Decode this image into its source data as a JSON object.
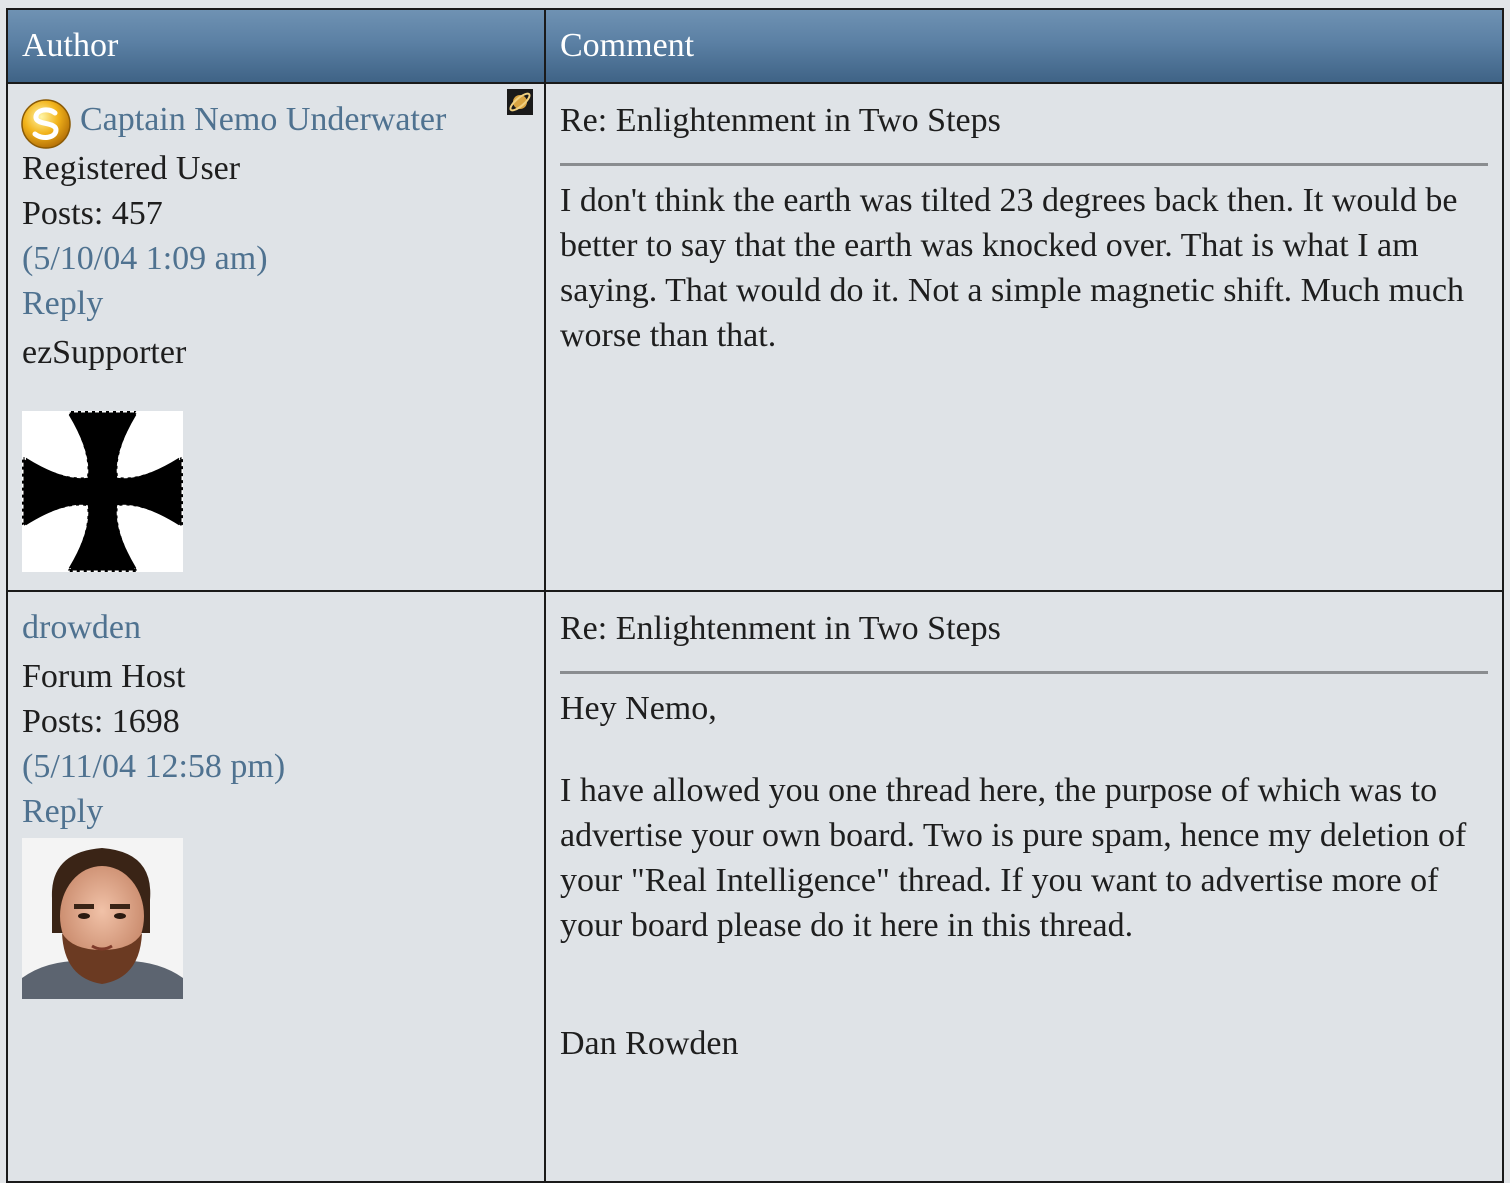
{
  "header": {
    "author_label": "Author",
    "comment_label": "Comment"
  },
  "posts": [
    {
      "author_name": "Captain Nemo Underwater",
      "role": "Registered User",
      "posts": "Posts: 457",
      "timestamp": "(5/10/04 1:09 am)",
      "reply_label": "Reply",
      "badge": "ezSupporter",
      "avatar_icon": "iron-cross",
      "subject": "Re: Enlightenment in Two Steps",
      "body": "I don't think the earth was tilted 23 degrees back then. It would be better to say that the earth was knocked over. That is what I am saying. That would do it. Not a simple magnetic shift. Much much worse than that."
    },
    {
      "author_name": "drowden",
      "role": "Forum Host",
      "posts": "Posts: 1698",
      "timestamp": "(5/11/04 12:58 pm)",
      "reply_label": "Reply",
      "avatar_icon": "user-photo",
      "subject": "Re: Enlightenment in Two Steps",
      "body_p1": "Hey Nemo,",
      "body_p2": "I have allowed you one thread here, the purpose of which was to advertise your own board. Two is pure spam, hence my deletion of your \"Real Intelligence\" thread. If you want to advertise more of your board please do it here in this thread.",
      "body_p3": "Dan Rowden"
    }
  ],
  "colors": {
    "header_top": "#6f92b3",
    "header_bottom": "#3f6386",
    "link": "#4f7290",
    "cell_bg": "#dfe3e7"
  }
}
